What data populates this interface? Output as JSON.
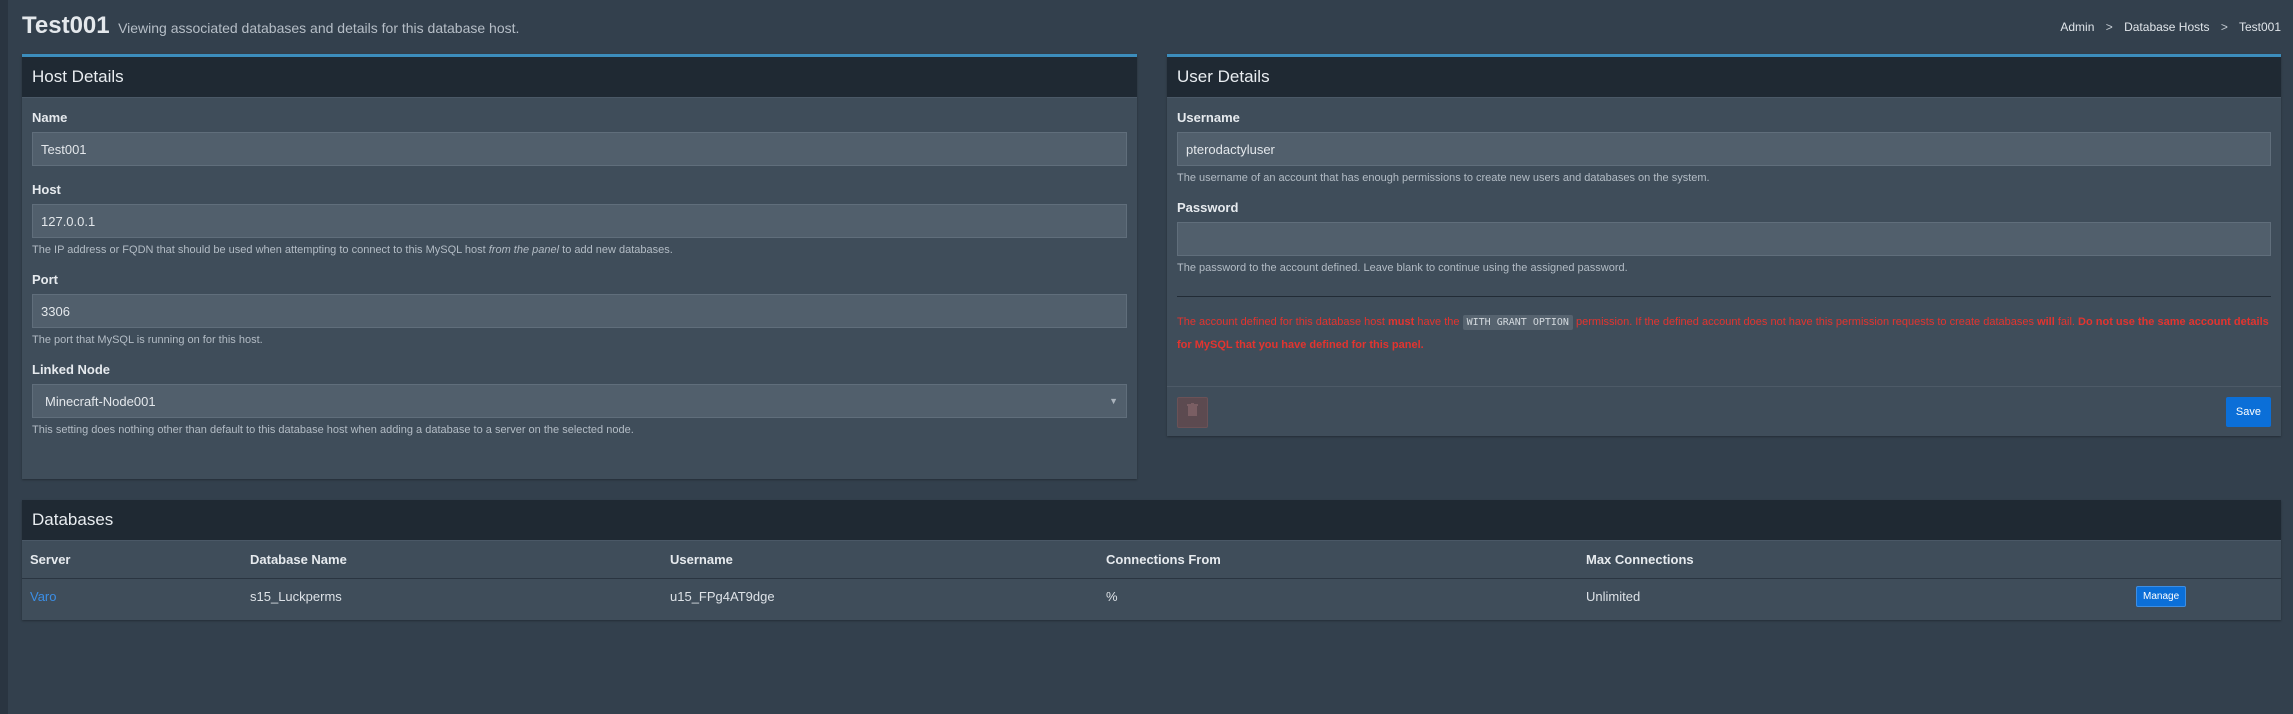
{
  "page": {
    "title": "Test001",
    "subtitle": "Viewing associated databases and details for this database host."
  },
  "breadcrumb": [
    "Admin",
    "Database Hosts",
    "Test001"
  ],
  "host_details": {
    "header": "Host Details",
    "name_label": "Name",
    "name_value": "Test001",
    "host_label": "Host",
    "host_value": "127.0.0.1",
    "host_help_pre": "The IP address or FQDN that should be used when attempting to connect to this MySQL host ",
    "host_help_em": "from the panel",
    "host_help_post": " to add new databases.",
    "port_label": "Port",
    "port_value": "3306",
    "port_help": "The port that MySQL is running on for this host.",
    "node_label": "Linked Node",
    "node_value": "Minecraft-Node001",
    "node_help": "This setting does nothing other than default to this database host when adding a database to a server on the selected node."
  },
  "user_details": {
    "header": "User Details",
    "username_label": "Username",
    "username_value": "pterodactyluser",
    "username_help": "The username of an account that has enough permissions to create new users and databases on the system.",
    "password_label": "Password",
    "password_value": "",
    "password_help": "The password to the account defined. Leave blank to continue using the assigned password.",
    "warning_1": "The account defined for this database host ",
    "warning_2": "must",
    "warning_3": " have the ",
    "warning_code": "WITH GRANT OPTION",
    "warning_4": " permission. If the defined account does not have this permission requests to create databases ",
    "warning_5": "will",
    "warning_6": " fail. ",
    "warning_7": "Do not use the same account details for MySQL that you have defined for this panel.",
    "save_label": "Save"
  },
  "databases": {
    "header": "Databases",
    "columns": [
      "Server",
      "Database Name",
      "Username",
      "Connections From",
      "Max Connections"
    ],
    "rows": [
      {
        "server": "Varo",
        "database_name": "s15_Luckperms",
        "username": "u15_FPg4AT9dge",
        "connections_from": "%",
        "max_connections": "Unlimited",
        "action": "Manage"
      }
    ]
  },
  "icons": {
    "delete": "trash-icon",
    "select": "chevron-down-icon"
  },
  "colors": {
    "accent": "#3c8dbc",
    "primary_button": "#0b6fd8",
    "warning_text": "#e3342f",
    "link": "#3b8ee5"
  }
}
